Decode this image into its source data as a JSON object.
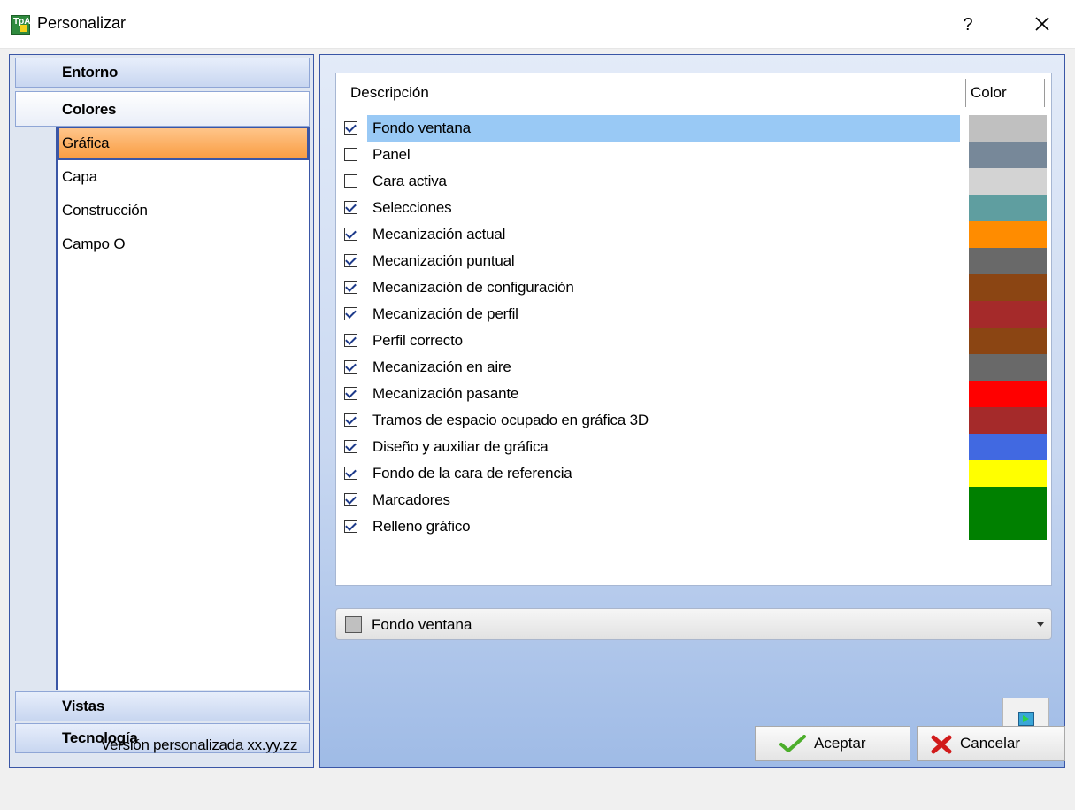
{
  "window": {
    "title": "Personalizar",
    "help_label": "?",
    "app_icon_text": "TpA"
  },
  "nav": {
    "groups": {
      "entorno": "Entorno",
      "colores": "Colores",
      "vistas": "Vistas",
      "tecnologia": "Tecnología"
    },
    "items": [
      "Gráfica",
      "Capa",
      "Construcción",
      "Campo O"
    ],
    "selected_item": "Gráfica"
  },
  "table": {
    "headers": {
      "description": "Descripción",
      "color": "Color"
    },
    "rows": [
      {
        "label": "Fondo ventana",
        "checked": true,
        "color": "#c0c0c0",
        "selected": true
      },
      {
        "label": "Panel",
        "checked": false,
        "color": "#778899",
        "selected": false
      },
      {
        "label": "Cara activa",
        "checked": false,
        "color": "#d3d3d3",
        "selected": false
      },
      {
        "label": "Selecciones",
        "checked": true,
        "color": "#5f9ea0",
        "selected": false
      },
      {
        "label": "Mecanización actual",
        "checked": true,
        "color": "#ff8c00",
        "selected": false
      },
      {
        "label": "Mecanización puntual",
        "checked": true,
        "color": "#696969",
        "selected": false
      },
      {
        "label": "Mecanización de configuración",
        "checked": true,
        "color": "#8b4513",
        "selected": false
      },
      {
        "label": "Mecanización de perfil",
        "checked": true,
        "color": "#a52a2a",
        "selected": false
      },
      {
        "label": "Perfil correcto",
        "checked": true,
        "color": "#8b4513",
        "selected": false
      },
      {
        "label": "Mecanización en aire",
        "checked": true,
        "color": "#696969",
        "selected": false
      },
      {
        "label": "Mecanización pasante",
        "checked": true,
        "color": "#ff0000",
        "selected": false
      },
      {
        "label": "Tramos de espacio ocupado en gráfica 3D",
        "checked": true,
        "color": "#a52a2a",
        "selected": false
      },
      {
        "label": "Diseño y auxiliar de gráfica",
        "checked": true,
        "color": "#4169e1",
        "selected": false
      },
      {
        "label": "Fondo de la cara de referencia",
        "checked": true,
        "color": "#ffff00",
        "selected": false
      },
      {
        "label": "Marcadores",
        "checked": true,
        "color": "#008000",
        "selected": false
      },
      {
        "label": "Relleno gráfico",
        "checked": true,
        "color": "#008000",
        "selected": false
      }
    ]
  },
  "combo": {
    "value": "Fondo ventana",
    "swatch_color": "#c0c0c0"
  },
  "footer": {
    "version": "Versión personalizada xx.yy.zz",
    "ok_label": "Aceptar",
    "cancel_label": "Cancelar"
  },
  "colors": {
    "accent_border": "#3a56a6",
    "selection_row": "#99c9f5",
    "nav_selected": "#f99d42"
  }
}
